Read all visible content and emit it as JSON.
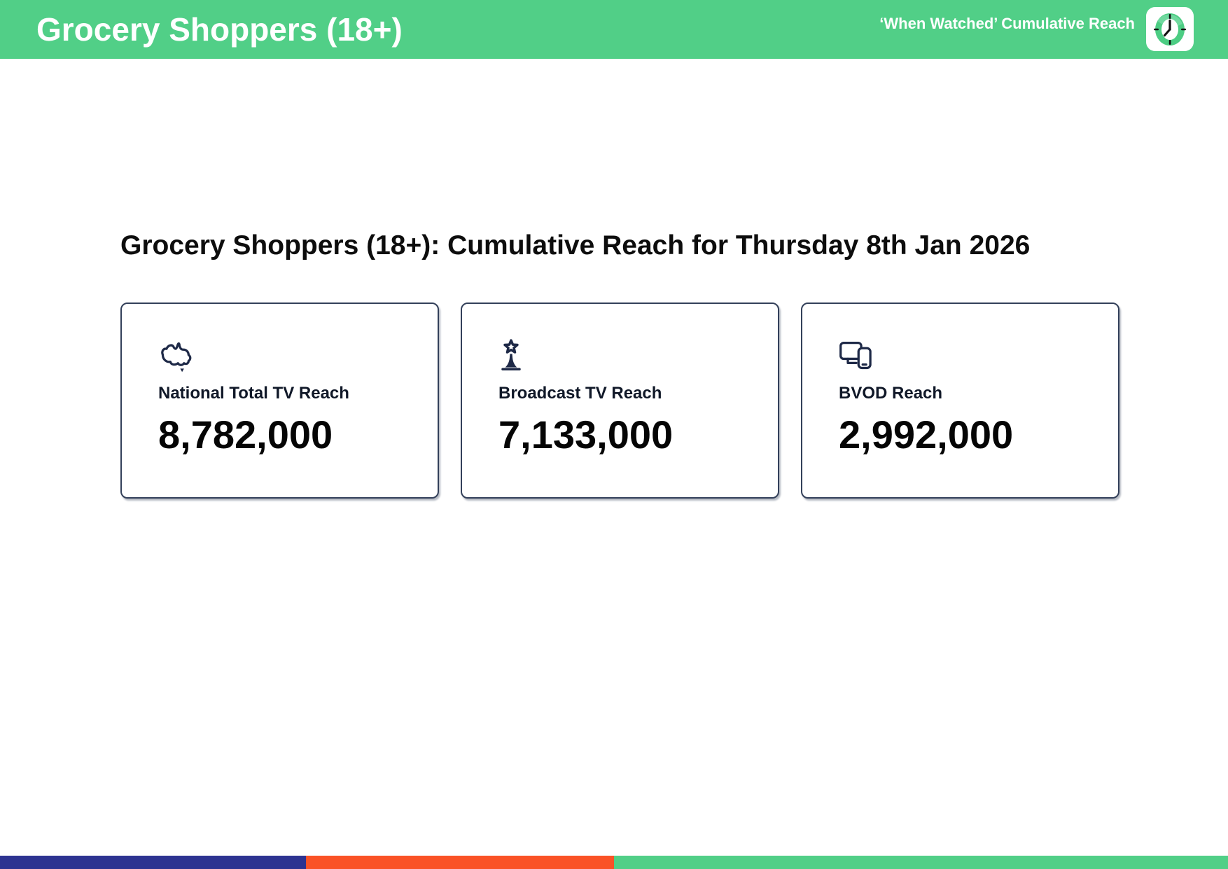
{
  "header": {
    "title": "Grocery Shoppers (18+)",
    "subtitle": "‘When Watched’ Cumulative Reach",
    "logo_icon": "clock-icon"
  },
  "main": {
    "heading": "Grocery Shoppers (18+): Cumulative Reach for Thursday 8th Jan 2026",
    "cards": [
      {
        "icon": "australia-map-icon",
        "label": "National Total TV Reach",
        "value": "8,782,000"
      },
      {
        "icon": "broadcast-tower-icon",
        "label": "Broadcast TV Reach",
        "value": "7,133,000"
      },
      {
        "icon": "devices-icon",
        "label": "BVOD Reach",
        "value": "2,992,000"
      }
    ]
  },
  "footer": {
    "segments": [
      {
        "name": "navy-segment",
        "color": "#2D3391"
      },
      {
        "name": "orange-segment",
        "color": "#FA5226"
      },
      {
        "name": "green-segment",
        "color": "#51CF87"
      }
    ]
  },
  "colors": {
    "header_green": "#51CF87",
    "icon_navy": "#1E2947",
    "card_border": "#33405A"
  }
}
